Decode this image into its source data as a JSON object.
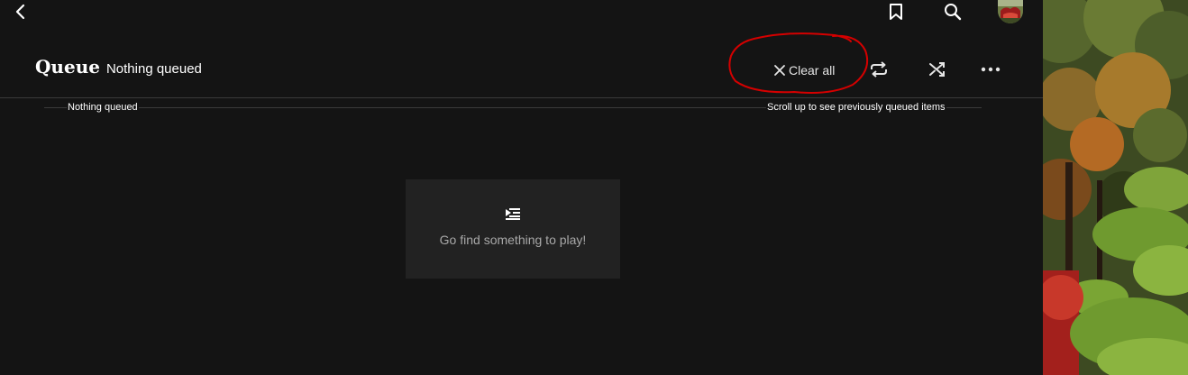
{
  "header": {
    "title": "Queue",
    "subtitle": "Nothing queued",
    "back_icon": "chevron-left-icon",
    "bookmark_icon": "bookmark-icon",
    "search_icon": "search-icon",
    "avatar_icon": "user-avatar"
  },
  "toolbar": {
    "clear_all_label": "Clear all",
    "clear_icon": "close-icon",
    "repeat_icon": "repeat-icon",
    "shuffle_icon": "shuffle-icon",
    "more_icon": "more-horizontal-icon"
  },
  "sections": {
    "left_label": "Nothing queued",
    "right_label": "Scroll up to see previously queued items"
  },
  "empty_state": {
    "icon": "queue-icon",
    "message": "Go find something to play!"
  },
  "colors": {
    "background": "#141414",
    "card": "#222222",
    "annotation": "#d40000"
  }
}
